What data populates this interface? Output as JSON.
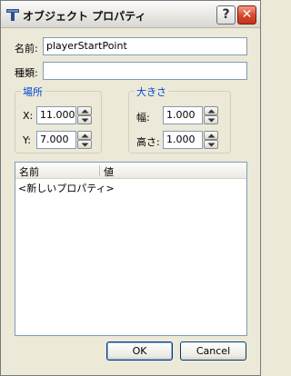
{
  "window": {
    "title": "オブジェクト プロパティ",
    "help_label": "?",
    "close_label": "✕"
  },
  "form": {
    "name_label": "名前:",
    "name_value": "playerStartPoint",
    "type_label": "種類:",
    "type_value": ""
  },
  "location": {
    "title": "場所",
    "x_label": "X:",
    "x_value": "11.000",
    "y_label": "Y:",
    "y_value": "7.000"
  },
  "size": {
    "title": "大きさ",
    "width_label": "幅:",
    "width_value": "1.000",
    "height_label": "高さ:",
    "height_value": "1.000"
  },
  "properties": {
    "columns": [
      "名前",
      "値"
    ],
    "rows": [
      "<新しいプロパティ>"
    ]
  },
  "buttons": {
    "ok_label": "OK",
    "cancel_label": "Cancel"
  },
  "icons": {
    "app": "tiled-object-icon",
    "spin_up": "arrow-up-icon",
    "spin_down": "arrow-down-icon"
  }
}
